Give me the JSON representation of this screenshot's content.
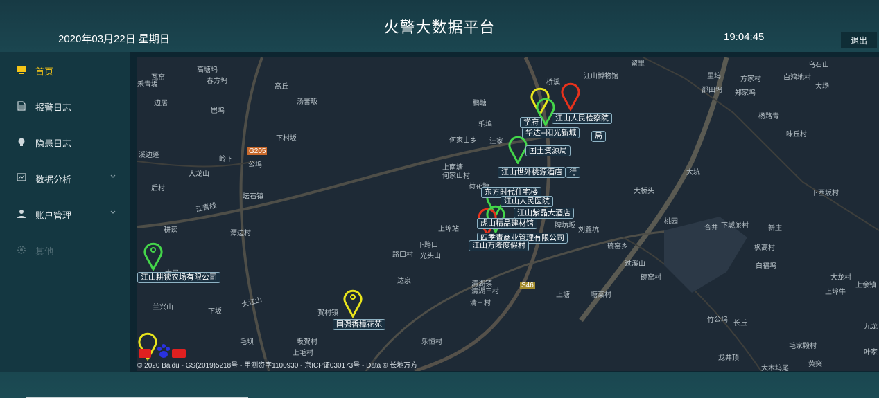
{
  "header": {
    "title": "火警大数据平台",
    "date": "2020年03月22日 星期日",
    "time": "19:04:45",
    "logout_label": "退出"
  },
  "sidebar": {
    "items": [
      {
        "label": "首页",
        "icon": "monitor-icon",
        "active": true
      },
      {
        "label": "报警日志",
        "icon": "document-icon"
      },
      {
        "label": "隐患日志",
        "icon": "bulb-icon"
      },
      {
        "label": "数据分析",
        "icon": "chart-icon",
        "expandable": true
      },
      {
        "label": "账户管理",
        "icon": "user-icon",
        "expandable": true
      },
      {
        "label": "其他",
        "icon": "gear-icon",
        "disabled": true
      }
    ]
  },
  "map": {
    "places": [
      "高塘坞",
      "瓦窑",
      "春方坞",
      "高丘",
      "边居",
      "岜坞",
      "汤蕃畈",
      "下村坂",
      "溪边蓬",
      "岭下",
      "公坞",
      "大龙山",
      "后村",
      "江青线",
      "坛石镇",
      "耕读",
      "潭边村",
      "大屋",
      "路口村",
      "下路口",
      "光头山",
      "达泉",
      "清湖镇",
      "上塘",
      "塘莱村",
      "刘鑫坑",
      "过溪山",
      "碗窑村",
      "大龙村",
      "上埠牛",
      "竹公坞",
      "长丘",
      "毛家殿村",
      "龙井顶",
      "大木坞尾",
      "黄突",
      "九龙",
      "叶家",
      "上余镇",
      "大桥头",
      "桃园",
      "合井",
      "下城淤村",
      "新庄",
      "大坑",
      "下西坂村",
      "留里",
      "里坞",
      "方家村",
      "白鸿地村",
      "乌石山",
      "大场",
      "邵田坞",
      "郑家坞",
      "杨路青",
      "味丘村",
      "上埠站",
      "江山博物馆",
      "桥溪",
      "何家山乡",
      "汪家",
      "上南塘",
      "何家山村",
      "荷花塘",
      "毛坞",
      "贺村镇",
      "兰兴山",
      "大江山",
      "毛坝",
      "下坂",
      "清湖三村",
      "清三村",
      "乐恒村",
      "坂贺村",
      "上毛村",
      "禾青坂",
      "S46",
      "G205",
      "鹏塘",
      "牌坊坂",
      "白福坞",
      "碗窑乡",
      "枫高村"
    ],
    "pins": [
      {
        "label": "江山人民检察院",
        "color": "red"
      },
      {
        "label": "学府",
        "color": "yellow"
      },
      {
        "label": "华达--阳光新城",
        "color": "green"
      },
      {
        "label": "局",
        "color": "red"
      },
      {
        "label": "国土资源局",
        "color": "green"
      },
      {
        "label": "江山世外桃源酒店",
        "color": "green"
      },
      {
        "label": "行",
        "color": "red"
      },
      {
        "label": "东方时代住宅楼",
        "color": "yellow"
      },
      {
        "label": "江山人民医院",
        "color": "green"
      },
      {
        "label": "江山紫晶大酒店",
        "color": "green"
      },
      {
        "label": "虎山精品建材馆",
        "color": "red"
      },
      {
        "label": "四季青商业管理有限公司",
        "color": "green"
      },
      {
        "label": "江山万隆度假村",
        "color": "green"
      },
      {
        "label": "江山耕读农场有限公司",
        "color": "green"
      },
      {
        "label": "国强香樟花苑",
        "color": "yellow"
      }
    ],
    "copyright": "© 2020 Baidu - GS(2019)5218号 - 甲测资字1100930 - 京ICP证030173号 - Data © 长地万方",
    "logo_text": "Bai 地图"
  },
  "colors": {
    "red": "#e8321c",
    "yellow": "#e8e41c",
    "green": "#44d64a",
    "active": "#f5c518"
  }
}
